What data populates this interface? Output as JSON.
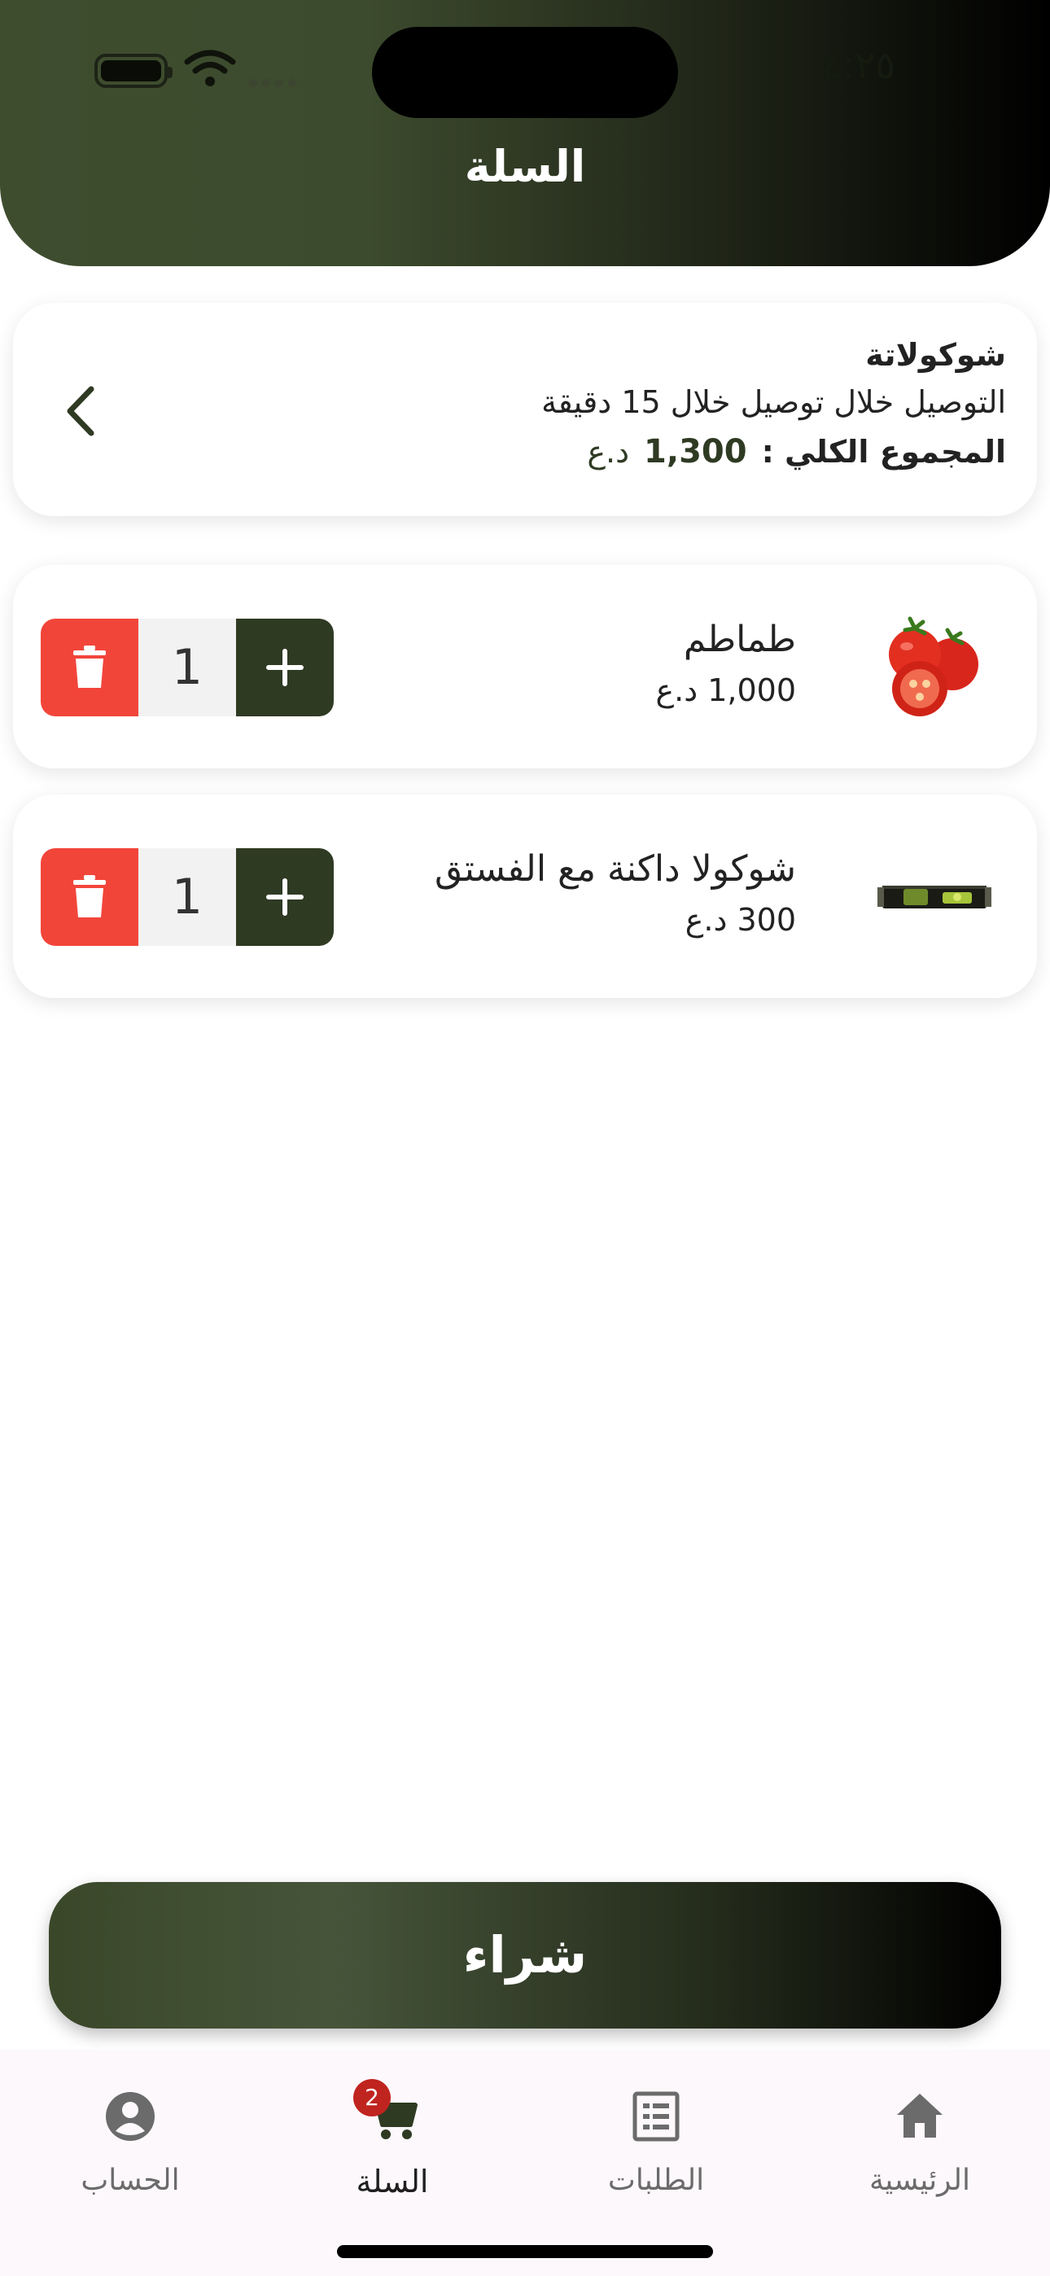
{
  "status_bar": {
    "time": "٤:٢٥"
  },
  "header": {
    "title": "السلة"
  },
  "store": {
    "name": "شوكولاتة",
    "delivery": "التوصيل خلال توصيل خلال 15 دقيقة",
    "total_label": "المجموع الكلي :",
    "total_value": "1,300",
    "currency": "د.ع"
  },
  "items": [
    {
      "name": "طماطم",
      "price": "1,000 د.ع",
      "quantity": "1",
      "image_icon": "tomato-image"
    },
    {
      "name": "شوكولا داكنة مع الفستق",
      "price": "300 د.ع",
      "quantity": "1",
      "image_icon": "chocolate-bar-image"
    }
  ],
  "buy_button": {
    "label": "شراء"
  },
  "tabbar": {
    "account": {
      "label": "الحساب",
      "icon": "account-icon"
    },
    "cart": {
      "label": "السلة",
      "icon": "cart-icon",
      "badge": "2"
    },
    "orders": {
      "label": "الطلبات",
      "icon": "orders-icon"
    },
    "home": {
      "label": "الرئيسية",
      "icon": "home-icon"
    }
  },
  "colors": {
    "primary": "#2f3a23",
    "delete": "#f2453a",
    "badge": "#c0241f"
  }
}
